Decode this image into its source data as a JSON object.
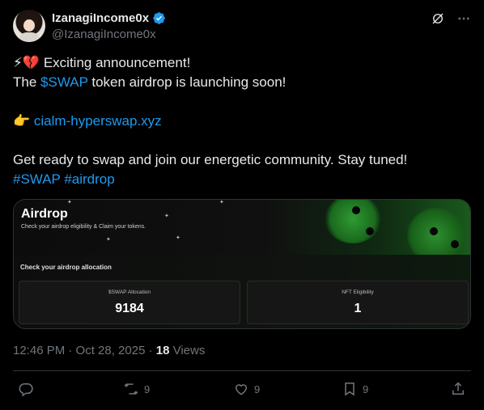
{
  "author": {
    "display_name": "IzanagiIncome0x",
    "handle": "@IzanagiIncome0x",
    "verified_badge": "verified-badge-icon"
  },
  "tweet": {
    "line1_emoji": "⚡💔",
    "line1_text": "Exciting announcement!",
    "line2_pre": "The ",
    "line2_cashtag": "$SWAP",
    "line2_post": " token airdrop is launching soon!",
    "line3_emoji": "👉",
    "line3_link": "cialm-hyperswap.xyz",
    "line4_text": "Get ready to swap and join our energetic community. Stay tuned!",
    "hashtag1": "#SWAP",
    "hashtag2": "#airdrop"
  },
  "card": {
    "title": "Airdrop",
    "subtitle": "Check your airdrop eligibility & Claim your tokens.",
    "section_title": "Check your airdrop allocation",
    "stats": [
      {
        "label": "$SWAP Allocation",
        "value": "9184"
      },
      {
        "label": "NFT Eligibility",
        "value": "1"
      }
    ]
  },
  "meta": {
    "timestamp": "12:46 PM · Oct 28, 2025 · ",
    "views_count": "18",
    "views_label": " Views"
  },
  "actions": {
    "reply_count": "",
    "retweet_count": "9",
    "like_count": "9",
    "bookmark_count": "9"
  },
  "colors": {
    "background": "#000000",
    "text": "#e7e9ea",
    "muted": "#71767b",
    "link": "#1d9bf0",
    "verified": "#1d9bf0",
    "accent_green": "#2f9a33"
  }
}
